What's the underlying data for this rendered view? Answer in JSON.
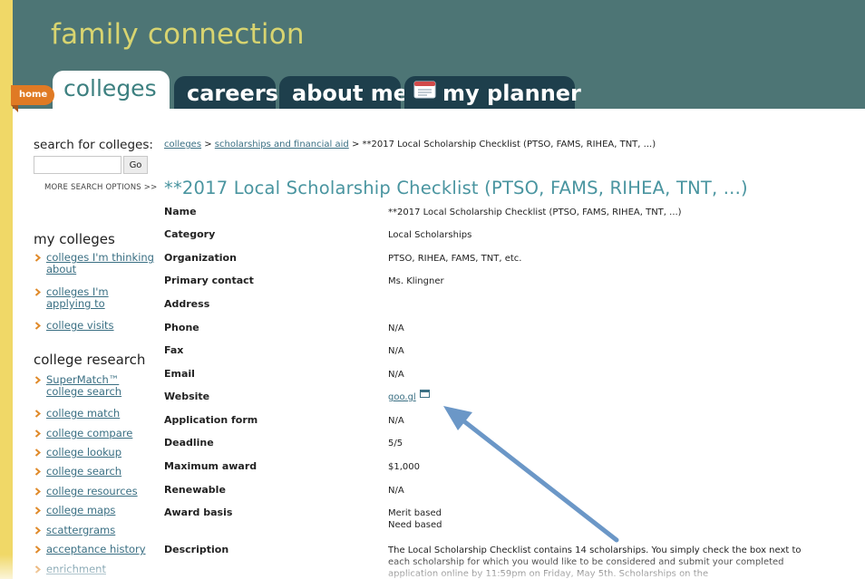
{
  "header": {
    "title": "family connection",
    "home_badge": "home",
    "tabs": {
      "colleges": "colleges",
      "careers": "careers",
      "about_me": "about me",
      "my_planner": "my planner"
    }
  },
  "sidebar": {
    "search_label": "search for colleges:",
    "search_value": "",
    "go_label": "Go",
    "more_options": "MORE SEARCH OPTIONS >>",
    "my_colleges_title": "my colleges",
    "my_colleges": [
      "colleges I'm thinking about",
      "colleges I'm applying to",
      "college visits"
    ],
    "research_title": "college research",
    "research": [
      "SuperMatch™ college search",
      "college match",
      "college compare",
      "college lookup",
      "college search",
      "college resources",
      "college maps",
      "scattergrams",
      "acceptance history",
      "enrichment"
    ]
  },
  "main": {
    "breadcrumb": {
      "link1": "colleges",
      "sep1": " > ",
      "link2": "scholarships and financial aid",
      "sep2": " > ",
      "current": "**2017 Local Scholarship Checklist (PTSO, FAMS, RIHEA, TNT, ...)"
    },
    "title": "**2017 Local Scholarship Checklist (PTSO, FAMS, RIHEA, TNT, ...)",
    "rows": [
      {
        "label": "Name",
        "value": "**2017 Local Scholarship Checklist (PTSO, FAMS, RIHEA, TNT, ...)"
      },
      {
        "label": "Category",
        "value": "Local Scholarships"
      },
      {
        "label": "Organization",
        "value": "PTSO, RIHEA, FAMS, TNT, etc."
      },
      {
        "label": "Primary contact",
        "value": "Ms. Klingner"
      },
      {
        "label": "Address",
        "value": ""
      },
      {
        "label": "Phone",
        "value": "N/A"
      },
      {
        "label": "Fax",
        "value": "N/A"
      },
      {
        "label": "Email",
        "value": "N/A"
      },
      {
        "label": "Website",
        "value": "goo.gl"
      },
      {
        "label": "Application form",
        "value": "N/A"
      },
      {
        "label": "Deadline",
        "value": "5/5"
      },
      {
        "label": "Maximum award",
        "value": "$1,000"
      },
      {
        "label": "Renewable",
        "value": "N/A"
      },
      {
        "label": "Award basis",
        "value": "Merit based",
        "value2": "Need based"
      },
      {
        "label": "Description",
        "value": "The Local Scholarship Checklist contains 14 scholarships. You simply check the box next to each scholarship for which you would like to be considered and submit your completed application online by 11:59pm on Friday, May 5th. Scholarships on the"
      }
    ]
  },
  "colors": {
    "header_bg": "#4d7575",
    "tab_bg": "#1e3f4c",
    "title_color": "#d8d470",
    "link": "#3a6f83",
    "accent_orange": "#e07a24",
    "strip_yellow": "#f0d867",
    "arrow": "#6b97c7"
  }
}
